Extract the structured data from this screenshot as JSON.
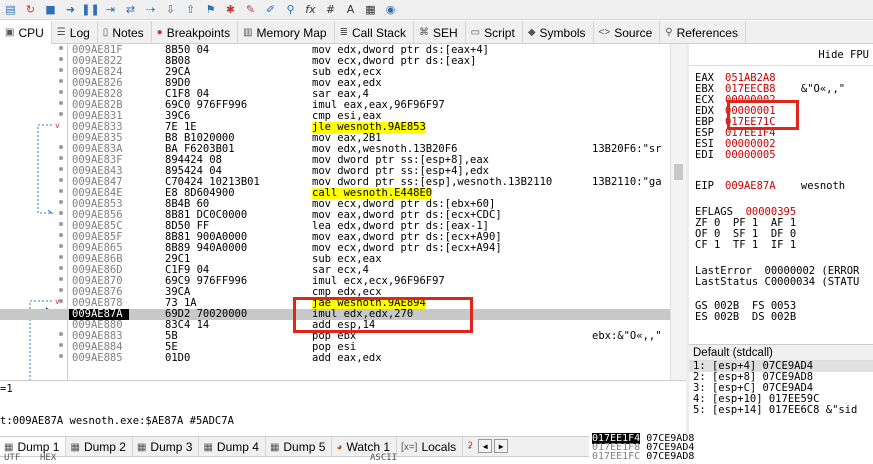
{
  "toolbar": {
    "icons": [
      "open-icon",
      "restart-icon",
      "close-icon",
      "run-icon",
      "pause-icon",
      "step-into-icon",
      "step-over-icon",
      "step-out-icon",
      "run-to-user-icon",
      "trace-icon",
      "patch-icon",
      "bug-icon",
      "comment-icon",
      "label-icon",
      "bookmark-icon",
      "function-icon",
      "hash-icon",
      "settings-icon",
      "calculator-icon",
      "globe-icon"
    ]
  },
  "tabs": [
    {
      "label": "CPU",
      "icon": "cpu-icon"
    },
    {
      "label": "Log",
      "icon": "log-icon"
    },
    {
      "label": "Notes",
      "icon": "notes-icon"
    },
    {
      "label": "Breakpoints",
      "icon": "breakpoint-icon"
    },
    {
      "label": "Memory Map",
      "icon": "memory-icon"
    },
    {
      "label": "Call Stack",
      "icon": "callstack-icon"
    },
    {
      "label": "SEH",
      "icon": "seh-icon"
    },
    {
      "label": "Script",
      "icon": "script-icon"
    },
    {
      "label": "Symbols",
      "icon": "symbols-icon"
    },
    {
      "label": "Source",
      "icon": "source-icon"
    },
    {
      "label": "References",
      "icon": "references-icon"
    }
  ],
  "disasm": [
    {
      "addr": "009AE81F",
      "bytes": "8B50 04",
      "instr": "mov edx,dword ptr ds:[eax+4]",
      "cmt": ""
    },
    {
      "addr": "009AE822",
      "bytes": "8B08",
      "instr": "mov ecx,dword ptr ds:[eax]",
      "cmt": ""
    },
    {
      "addr": "009AE824",
      "bytes": "29CA",
      "instr": "sub edx,ecx",
      "cmt": ""
    },
    {
      "addr": "009AE826",
      "bytes": "89D0",
      "instr": "mov eax,edx",
      "cmt": ""
    },
    {
      "addr": "009AE828",
      "bytes": "C1F8 04",
      "instr": "sar eax,4",
      "cmt": ""
    },
    {
      "addr": "009AE82B",
      "bytes": "69C0 976FF996",
      "instr": "imul eax,eax,96F96F97",
      "cmt": ""
    },
    {
      "addr": "009AE831",
      "bytes": "39C6",
      "instr": "cmp esi,eax",
      "cmt": ""
    },
    {
      "addr": "009AE833",
      "bytes": "7E 1E",
      "instr": "jle wesnoth.9AE853",
      "cmt": "",
      "hl": "y"
    },
    {
      "addr": "009AE835",
      "bytes": "B8 B1020000",
      "instr": "mov eax,2B1",
      "cmt": ""
    },
    {
      "addr": "009AE83A",
      "bytes": "BA F6203B01",
      "instr": "mov edx,wesnoth.13B20F6",
      "cmt": "13B20F6:\"sr"
    },
    {
      "addr": "009AE83F",
      "bytes": "894424 08",
      "instr": "mov dword ptr ss:[esp+8],eax",
      "cmt": ""
    },
    {
      "addr": "009AE843",
      "bytes": "895424 04",
      "instr": "mov dword ptr ss:[esp+4],edx",
      "cmt": ""
    },
    {
      "addr": "009AE847",
      "bytes": "C70424 10213B01",
      "instr": "mov dword ptr ss:[esp],wesnoth.13B2110",
      "cmt": "13B2110:\"ga"
    },
    {
      "addr": "009AE84E",
      "bytes": "E8 8D604900",
      "instr": "call wesnoth.E448E0",
      "cmt": "",
      "hl": "y"
    },
    {
      "addr": "009AE853",
      "bytes": "8B4B 60",
      "instr": "mov ecx,dword ptr ds:[ebx+60]",
      "cmt": ""
    },
    {
      "addr": "009AE856",
      "bytes": "8B81 DC0C0000",
      "instr": "mov eax,dword ptr ds:[ecx+CDC]",
      "cmt": ""
    },
    {
      "addr": "009AE85C",
      "bytes": "8D50 FF",
      "instr": "lea edx,dword ptr ds:[eax-1]",
      "cmt": ""
    },
    {
      "addr": "009AE85F",
      "bytes": "8B81 900A0000",
      "instr": "mov eax,dword ptr ds:[ecx+A90]",
      "cmt": ""
    },
    {
      "addr": "009AE865",
      "bytes": "8B89 940A0000",
      "instr": "mov ecx,dword ptr ds:[ecx+A94]",
      "cmt": ""
    },
    {
      "addr": "009AE86B",
      "bytes": "29C1",
      "instr": "sub ecx,eax",
      "cmt": ""
    },
    {
      "addr": "009AE86D",
      "bytes": "C1F9 04",
      "instr": "sar ecx,4",
      "cmt": ""
    },
    {
      "addr": "009AE870",
      "bytes": "69C9 976FF996",
      "instr": "imul ecx,ecx,96F96F97",
      "cmt": ""
    },
    {
      "addr": "009AE876",
      "bytes": "39CA",
      "instr": "cmp edx,ecx",
      "cmt": ""
    },
    {
      "addr": "009AE878",
      "bytes": "73 1A",
      "instr": "jae wesnoth.9AE894",
      "cmt": "",
      "hl": "y"
    },
    {
      "addr": "009AE87A",
      "bytes": "69D2 70020000",
      "instr": "imul edx,edx,270",
      "cmt": "",
      "cur": true
    },
    {
      "addr": "009AE880",
      "bytes": "83C4 14",
      "instr": "add esp,14",
      "cmt": ""
    },
    {
      "addr": "009AE883",
      "bytes": "5B",
      "instr": "pop ebx",
      "cmt": "ebx:&\"O«,,\""
    },
    {
      "addr": "009AE884",
      "bytes": "5E",
      "instr": "pop esi",
      "cmt": ""
    },
    {
      "addr": "009AE885",
      "bytes": "01D0",
      "instr": "add eax,edx",
      "cmt": ""
    }
  ],
  "registers": {
    "header": "Hide FPU",
    "gp": [
      {
        "name": "EAX",
        "value": "051AB2A8",
        "extra": ""
      },
      {
        "name": "EBX",
        "value": "017EECB8",
        "extra": "&\"O«,,\""
      },
      {
        "name": "ECX",
        "value": "00000002",
        "extra": ""
      },
      {
        "name": "EDX",
        "value": "00000001",
        "extra": ""
      },
      {
        "name": "EBP",
        "value": "017EE71C",
        "extra": ""
      },
      {
        "name": "ESP",
        "value": "017EE1F4",
        "extra": ""
      },
      {
        "name": "ESI",
        "value": "00000002",
        "extra": ""
      },
      {
        "name": "EDI",
        "value": "00000005",
        "extra": ""
      }
    ],
    "eip": {
      "name": "EIP",
      "value": "009AE87A",
      "extra": "wesnoth"
    },
    "eflags": {
      "name": "EFLAGS",
      "value": "00000395"
    },
    "flags_rows": [
      "ZF 0  PF 1  AF 1",
      "OF 0  SF 1  DF 0",
      "CF 1  TF 1  IF 1"
    ],
    "last_error": "LastError  00000002 (ERROR",
    "last_status": "LastStatus C0000034 (STATU",
    "segs": [
      "GS 002B  FS 0053",
      "ES 002B  DS 002B"
    ]
  },
  "stack_args": {
    "header": "Default (stdcall)",
    "rows": [
      "1: [esp+4] 07CE9AD4",
      "2: [esp+8] 07CE9AD8",
      "3: [esp+C] 07CE9AD4",
      "4: [esp+10] 017EE59C",
      "5: [esp+14] 017EE6C8 &\"sid"
    ]
  },
  "info": {
    "line1": "=1",
    "line2": "t:009AE87A wesnoth.exe:$AE87A #5ADC7A"
  },
  "bottom_tabs": [
    {
      "label": "Dump 1",
      "icon": "dump-icon"
    },
    {
      "label": "Dump 2",
      "icon": "dump-icon"
    },
    {
      "label": "Dump 3",
      "icon": "dump-icon"
    },
    {
      "label": "Dump 4",
      "icon": "dump-icon"
    },
    {
      "label": "Dump 5",
      "icon": "dump-icon"
    },
    {
      "label": "Watch 1",
      "icon": "watch-icon"
    },
    {
      "label": "Locals",
      "icon": "locals-icon"
    }
  ],
  "dump_header": {
    "c1": "UTF",
    "c2": "HEX",
    "c3": "ASCII"
  },
  "mini_stack": [
    {
      "addr": "017EE1F4",
      "val": "07CE9AD8"
    },
    {
      "addr": "017EE1F8",
      "val": "07CE9AD4"
    },
    {
      "addr": "017EE1FC",
      "val": "07CE9AD8"
    }
  ]
}
